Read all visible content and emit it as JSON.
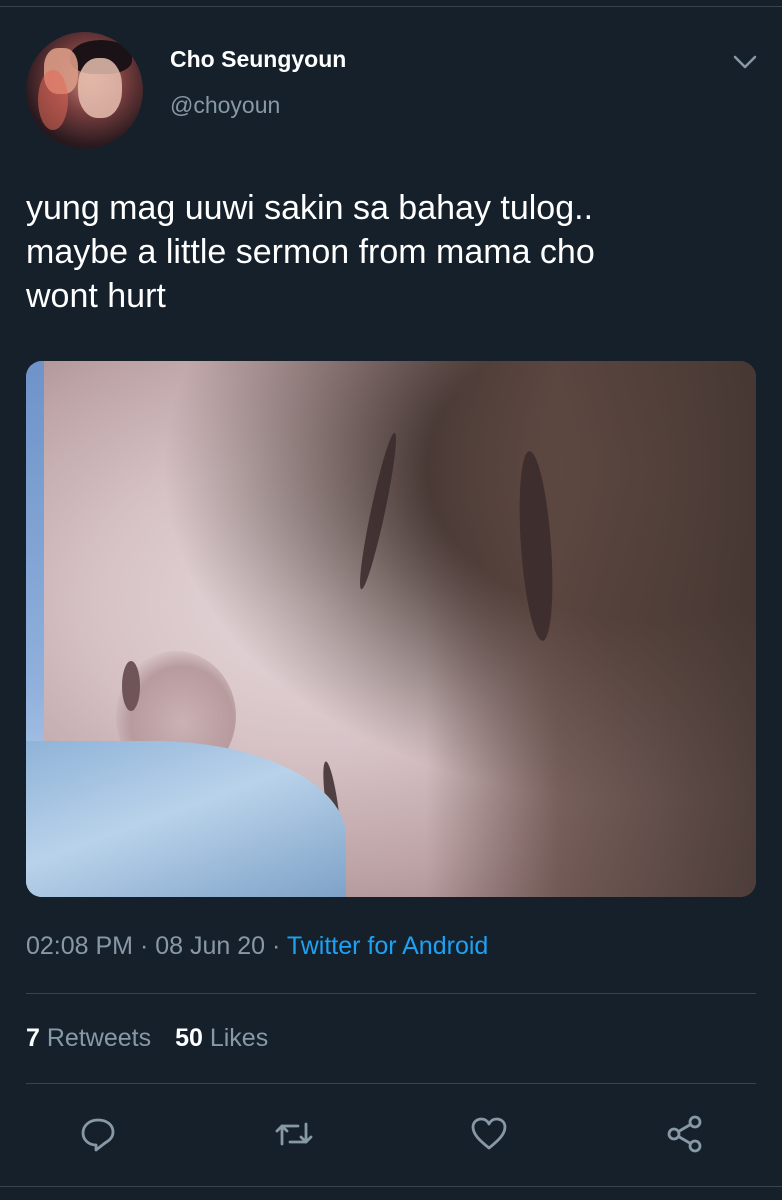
{
  "tweet": {
    "display_name": "Cho Seungyoun",
    "handle": "@choyoun",
    "text": "yung mag uuwi sakin sa bahay tulog..\nmaybe a little sermon from mama cho\nwont hurt",
    "time": "02:08 PM",
    "separator": " · ",
    "date": "08 Jun 20",
    "source": "Twitter for Android",
    "retweets_count": "7",
    "retweets_label": "Retweets",
    "likes_count": "50",
    "likes_label": "Likes"
  },
  "icons": {
    "more": "chevron-down-icon",
    "reply": "reply-icon",
    "retweet": "retweet-icon",
    "like": "heart-icon",
    "share": "share-icon"
  },
  "colors": {
    "background": "#15202b",
    "text": "#ffffff",
    "secondary_text": "#8899a6",
    "link": "#1da1f2",
    "divider": "#38444d"
  }
}
